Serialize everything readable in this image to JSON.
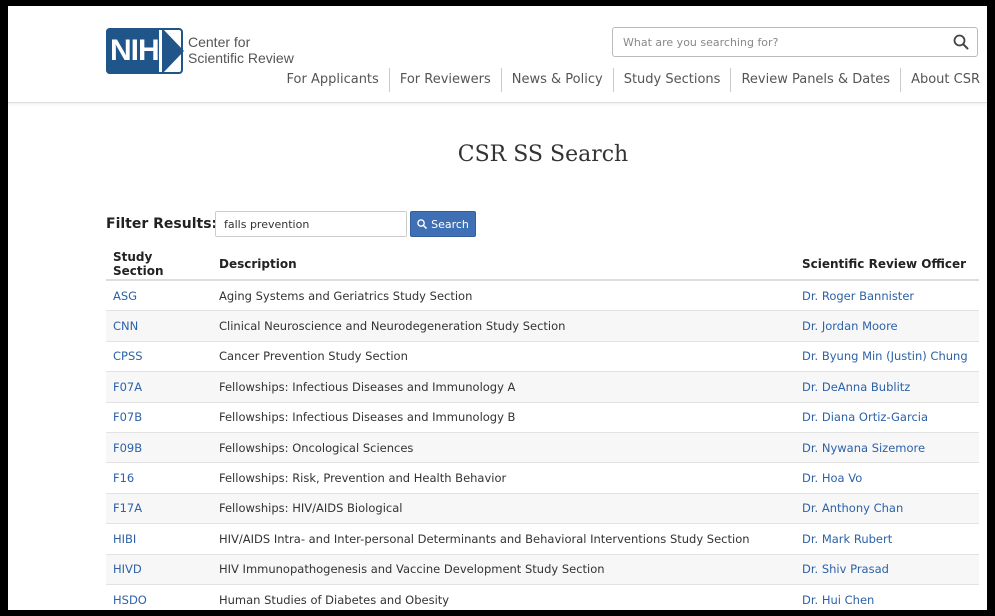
{
  "header": {
    "logo_text": "NIH",
    "org_name_line1": "Center for",
    "org_name_line2": "Scientific Review",
    "search_placeholder": "What are you searching for?",
    "nav": [
      {
        "label": "For Applicants"
      },
      {
        "label": "For Reviewers"
      },
      {
        "label": "News & Policy"
      },
      {
        "label": "Study Sections"
      },
      {
        "label": "Review Panels & Dates"
      },
      {
        "label": "About CSR"
      }
    ]
  },
  "main": {
    "title": "CSR SS Search",
    "filter": {
      "label": "Filter Results:",
      "value": "falls prevention",
      "button_label": "Search"
    },
    "table": {
      "headers": [
        "Study Section",
        "Description",
        "Scientific Review Officer"
      ],
      "rows": [
        {
          "code": "ASG",
          "description": "Aging Systems and Geriatrics Study Section",
          "officer": "Dr. Roger Bannister"
        },
        {
          "code": "CNN",
          "description": "Clinical Neuroscience and Neurodegeneration Study Section",
          "officer": "Dr. Jordan Moore"
        },
        {
          "code": "CPSS",
          "description": "Cancer Prevention Study Section",
          "officer": "Dr. Byung Min (Justin) Chung"
        },
        {
          "code": "F07A",
          "description": "Fellowships: Infectious Diseases and Immunology A",
          "officer": "Dr. DeAnna Bublitz"
        },
        {
          "code": "F07B",
          "description": "Fellowships: Infectious Diseases and Immunology B",
          "officer": "Dr. Diana Ortiz-Garcia"
        },
        {
          "code": "F09B",
          "description": "Fellowships: Oncological Sciences",
          "officer": "Dr. Nywana Sizemore"
        },
        {
          "code": "F16",
          "description": "Fellowships: Risk, Prevention and Health Behavior",
          "officer": "Dr. Hoa Vo"
        },
        {
          "code": "F17A",
          "description": "Fellowships: HIV/AIDS Biological",
          "officer": "Dr. Anthony Chan"
        },
        {
          "code": "HIBI",
          "description": "HIV/AIDS Intra- and Inter-personal Determinants and Behavioral Interventions Study Section",
          "officer": "Dr. Mark Rubert"
        },
        {
          "code": "HIVD",
          "description": "HIV Immunopathogenesis and Vaccine Development Study Section",
          "officer": "Dr. Shiv Prasad"
        },
        {
          "code": "HSDO",
          "description": "Human Studies of Diabetes and Obesity",
          "officer": "Dr. Hui Chen"
        }
      ]
    }
  },
  "colors": {
    "brand": "#20558a",
    "link": "#2d62a8",
    "button": "#3f6fb5"
  }
}
